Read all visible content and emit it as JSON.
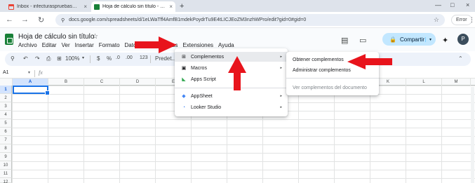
{
  "browser": {
    "tabs": [
      {
        "title": "Inbox - infecturaspruebas@gmail.com",
        "close": "×",
        "state": "inactive"
      },
      {
        "title": "Hoja de cálculo sin título - Hojas de cálculo",
        "close": "×",
        "state": "active"
      }
    ],
    "new_tab": "+",
    "window_controls": [
      "—",
      "□",
      "×"
    ],
    "nav": {
      "back": "←",
      "forward": "→",
      "reload": "↻"
    },
    "url": "docs.google.com/spreadsheets/d/1eLWaTff4AmfB1mdekPoydrTu9E4tLICJEoZM3nzhWPro/edit?gid=0#gid=0",
    "lock_icon": "⚲",
    "bookmark_star": "☆",
    "error_button": "Error",
    "menu_dots": "⋮"
  },
  "doc": {
    "title": "Hoja de cálculo sin título",
    "star": "☆",
    "menu": [
      "Archivo",
      "Editar",
      "Ver",
      "Insertar",
      "Formato",
      "Datos",
      "Herramientas",
      "Extensiones",
      "Ayuda"
    ],
    "share_label": "Compartir",
    "share_lock": "🔒",
    "share_caret": "▾",
    "avatar_letter": "P",
    "comment_icon": "▤",
    "meet_icon": "▭",
    "gemini_icon": "✦"
  },
  "toolbar": {
    "search": "⚲",
    "undo": "↶",
    "redo": "↷",
    "print": "⎙",
    "format_paint": "⊞",
    "zoom": "100%",
    "zoom_caret": "▾",
    "currency": "$",
    "percent": "%",
    "decrease_decimals": ".0",
    "increase_decimals": ".00",
    "number_format": "123",
    "font_label": "Predet...",
    "collapse": "⌃"
  },
  "formula_bar": {
    "cell_ref": "A1",
    "caret": "▾",
    "fx": "fx"
  },
  "grid": {
    "columns": [
      "A",
      "B",
      "C",
      "D",
      "E",
      "F",
      "G",
      "H",
      "I",
      "J",
      "K",
      "L",
      "M"
    ],
    "rows": [
      "1",
      "2",
      "3",
      "4",
      "5",
      "6",
      "7",
      "8",
      "9",
      "10",
      "11",
      "12"
    ]
  },
  "extensions_menu": {
    "items": [
      {
        "icon": "⊞",
        "label": "Complementos",
        "arrow": "▸"
      },
      {
        "icon": "▣",
        "label": "Macros",
        "arrow": "▸"
      },
      {
        "icon": "◣",
        "label": "Apps Script",
        "arrow": ""
      },
      {
        "icon": "◆",
        "label": "AppSheet",
        "arrow": "▸"
      },
      {
        "icon": "◔",
        "label": "Looker Studio",
        "arrow": "▸"
      }
    ]
  },
  "addons_submenu": {
    "items": [
      {
        "label": "Obtener complementos",
        "disabled": false
      },
      {
        "label": "Administrar complementos",
        "disabled": false
      },
      {
        "label": "Ver complementos del documento",
        "disabled": true
      }
    ]
  },
  "colors": {
    "annotation_red": "#e8141c",
    "selection_blue": "#1a73e8",
    "share_bg": "#c2e7ff",
    "sheets_green": "#188038"
  }
}
